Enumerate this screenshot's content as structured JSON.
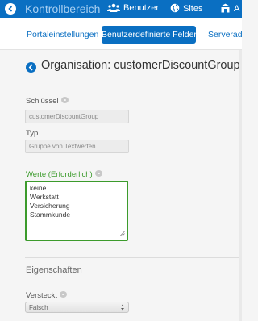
{
  "topbar": {
    "title": "Kontrollbereich",
    "nav": {
      "users": "Benutzer",
      "sites": "Sites",
      "apps": "A"
    }
  },
  "tabs": {
    "portal": "Portaleinstellungen",
    "custom_fields": "Benutzerdefinierte Felder",
    "server": "Serveradr"
  },
  "page": {
    "title": "Organisation: customerDiscountGroup"
  },
  "form": {
    "key": {
      "label": "Schlüssel",
      "value": "customerDiscountGroup"
    },
    "type": {
      "label": "Typ",
      "value": "Gruppe von Textwerten"
    },
    "values": {
      "label": "Werte (Erforderlich)",
      "lines": [
        "keine",
        "Werkstatt",
        "Versicherung",
        "Stammkunde"
      ]
    },
    "properties": {
      "heading": "Eigenschaften"
    },
    "hidden": {
      "label": "Versteckt",
      "value": "Falsch"
    }
  },
  "colors": {
    "brand": "#0a6fc2",
    "required": "#3c9b2c"
  }
}
